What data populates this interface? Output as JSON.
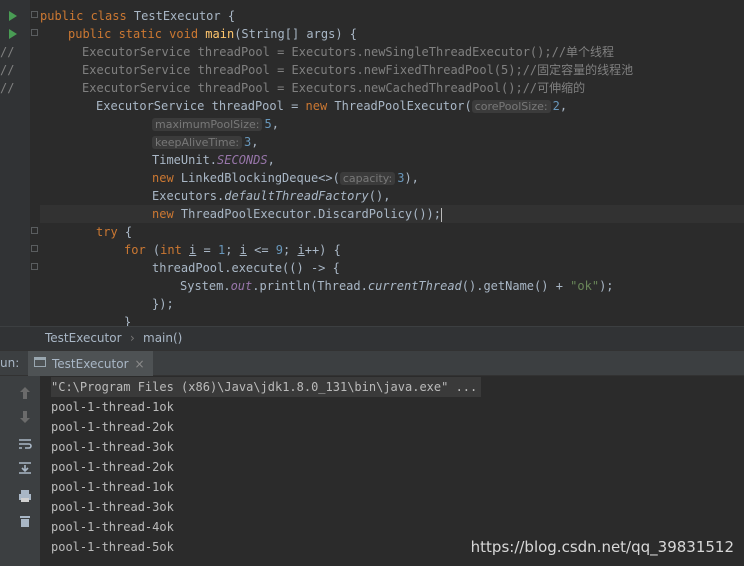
{
  "editor": {
    "lines": [
      {
        "indent": 0,
        "parts": [
          {
            "t": "public class ",
            "c": "kw"
          },
          {
            "t": "TestExecutor {"
          }
        ]
      },
      {
        "indent": 4,
        "parts": [
          {
            "t": "public static void ",
            "c": "kw"
          },
          {
            "t": "main",
            "c": "fn"
          },
          {
            "t": "(String[] args) {"
          }
        ]
      },
      {
        "prefix": "//",
        "indent": 6,
        "parts": [
          {
            "t": "ExecutorService threadPool = Executors.newSingleThreadExecutor();//单个线程",
            "c": "cm"
          }
        ]
      },
      {
        "prefix": "//",
        "indent": 6,
        "parts": [
          {
            "t": "ExecutorService threadPool = Executors.newFixedThreadPool(5);//固定容量的线程池",
            "c": "cm"
          }
        ]
      },
      {
        "prefix": "//",
        "indent": 6,
        "parts": [
          {
            "t": "ExecutorService threadPool = Executors.newCachedThreadPool();//可伸缩的",
            "c": "cm"
          }
        ]
      },
      {
        "indent": 8,
        "parts": [
          {
            "t": "ExecutorService threadPool = "
          },
          {
            "t": "new ",
            "c": "kw"
          },
          {
            "t": "ThreadPoolExecutor("
          },
          {
            "t": "corePoolSize:",
            "c": "hint"
          },
          {
            "t": "2",
            "c": "num"
          },
          {
            "t": ","
          }
        ]
      },
      {
        "indent": 16,
        "parts": [
          {
            "t": "maximumPoolSize:",
            "c": "hint"
          },
          {
            "t": "5",
            "c": "num"
          },
          {
            "t": ","
          }
        ]
      },
      {
        "indent": 16,
        "parts": [
          {
            "t": "keepAliveTime:",
            "c": "hint"
          },
          {
            "t": "3",
            "c": "num"
          },
          {
            "t": ","
          }
        ]
      },
      {
        "indent": 16,
        "parts": [
          {
            "t": "TimeUnit."
          },
          {
            "t": "SECONDS",
            "c": "itp"
          },
          {
            "t": ","
          }
        ]
      },
      {
        "indent": 16,
        "parts": [
          {
            "t": "new ",
            "c": "kw"
          },
          {
            "t": "LinkedBlockingDeque<>("
          },
          {
            "t": "capacity:",
            "c": "hint"
          },
          {
            "t": "3",
            "c": "num"
          },
          {
            "t": "),"
          }
        ]
      },
      {
        "indent": 16,
        "parts": [
          {
            "t": "Executors."
          },
          {
            "t": "defaultThreadFactory",
            "c": "it"
          },
          {
            "t": "(),"
          }
        ]
      },
      {
        "indent": 16,
        "parts": [
          {
            "t": "new ",
            "c": "kw"
          },
          {
            "t": "ThreadPoolExecutor.DiscardPolicy());"
          },
          {
            "t": "",
            "c": "caret"
          }
        ]
      },
      {
        "indent": 8,
        "parts": [
          {
            "t": "try ",
            "c": "kw"
          },
          {
            "t": "{"
          }
        ]
      },
      {
        "indent": 12,
        "parts": [
          {
            "t": "for ",
            "c": "kw"
          },
          {
            "t": "("
          },
          {
            "t": "int ",
            "c": "kw"
          },
          {
            "t": "i",
            "c": "ul"
          },
          {
            "t": " = "
          },
          {
            "t": "1",
            "c": "num"
          },
          {
            "t": "; "
          },
          {
            "t": "i",
            "c": "ul"
          },
          {
            "t": " <= "
          },
          {
            "t": "9",
            "c": "num"
          },
          {
            "t": "; "
          },
          {
            "t": "i",
            "c": "ul"
          },
          {
            "t": "++) {"
          }
        ]
      },
      {
        "indent": 16,
        "parts": [
          {
            "t": "threadPool.execute(() -> {"
          }
        ]
      },
      {
        "indent": 20,
        "parts": [
          {
            "t": "System."
          },
          {
            "t": "out",
            "c": "itp"
          },
          {
            "t": ".println(Thread."
          },
          {
            "t": "currentThread",
            "c": "it"
          },
          {
            "t": "().getName() + "
          },
          {
            "t": "\"ok\"",
            "c": "str"
          },
          {
            "t": ");"
          }
        ]
      },
      {
        "indent": 16,
        "parts": [
          {
            "t": "});"
          }
        ]
      },
      {
        "indent": 12,
        "parts": [
          {
            "t": "}"
          }
        ]
      }
    ]
  },
  "breadcrumb": {
    "class_name": "TestExecutor",
    "separator": "›",
    "method_name": "main()"
  },
  "run_panel": {
    "label": "un:",
    "tab_title": "TestExecutor",
    "close_glyph": "×"
  },
  "console": {
    "command": "\"C:\\Program Files (x86)\\Java\\jdk1.8.0_131\\bin\\java.exe\" ...",
    "output": [
      "pool-1-thread-1ok",
      "pool-1-thread-2ok",
      "pool-1-thread-3ok",
      "pool-1-thread-2ok",
      "pool-1-thread-1ok",
      "pool-1-thread-3ok",
      "pool-1-thread-4ok",
      "pool-1-thread-5ok"
    ]
  },
  "watermark": "https://blog.csdn.net/qq_39831512",
  "colors": {
    "background": "#2b2b2b",
    "keyword": "#cc7832",
    "method": "#ffc66d",
    "comment": "#808080",
    "number": "#6897bb",
    "string": "#6a8759",
    "run_arrow": "#499c54"
  },
  "icons": [
    "run-gutter-icon",
    "fold-marker-icon",
    "rerun-icon",
    "stop-icon",
    "soft-wrap-icon",
    "scroll-to-end-icon",
    "print-icon",
    "clear-all-icon",
    "close-icon",
    "console-tab-icon"
  ]
}
